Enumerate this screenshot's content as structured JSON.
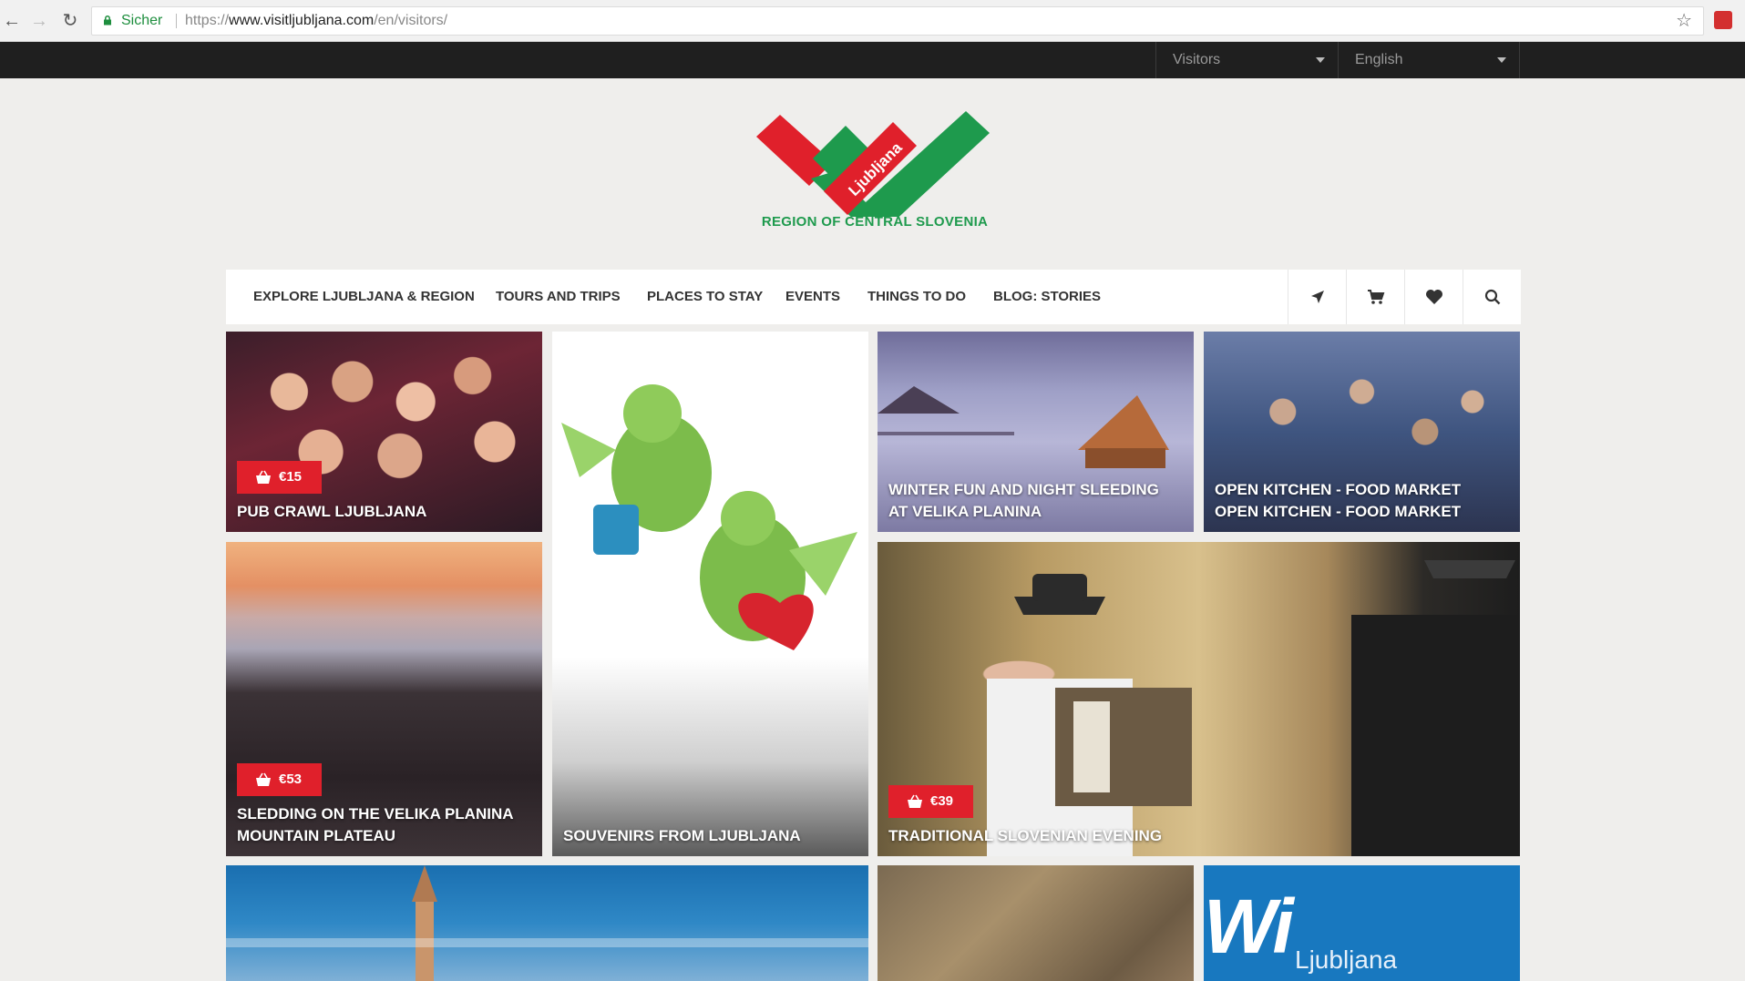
{
  "browser": {
    "secure_label": "Sicher",
    "url_prefix": "https://",
    "url_host": "www.visitljubljana.com",
    "url_path": "/en/visitors/"
  },
  "topbar": {
    "section_select": "Visitors",
    "language_select": "English"
  },
  "logo": {
    "wordmark": "Ljubljana",
    "tagline": "REGION OF CENTRAL SLOVENIA"
  },
  "nav": {
    "items": [
      "EXPLORE LJUBLJANA & REGION",
      "TOURS AND TRIPS",
      "PLACES TO STAY",
      "EVENTS",
      "THINGS TO DO",
      "BLOG: STORIES"
    ],
    "icons": [
      "location-arrow-icon",
      "cart-icon",
      "heart-icon",
      "search-icon"
    ]
  },
  "tiles": {
    "pub": {
      "price": "€15",
      "caption": "PUB CRAWL LJUBLJANA"
    },
    "souvenirs": {
      "caption": "SOUVENIRS FROM LJUBLJANA"
    },
    "winter": {
      "line1": "WINTER FUN AND NIGHT SLEEDING",
      "line2": "AT VELIKA PLANINA"
    },
    "kitchen": {
      "line1": "OPEN KITCHEN - FOOD MARKET",
      "line2": "OPEN KITCHEN - FOOD MARKET"
    },
    "sledding": {
      "price": "€53",
      "line1": "SLEDDING ON THE VELIKA PLANINA",
      "line2": "MOUNTAIN PLATEAU"
    },
    "traditional": {
      "price": "€39",
      "caption": "TRADITIONAL SLOVENIAN EVENING"
    },
    "wifi": {
      "big": "Wi",
      "small": "Ljubljana"
    }
  },
  "colors": {
    "brand_red": "#e0202b",
    "brand_green": "#1e9a4d",
    "topbar": "#1f1f1f"
  }
}
